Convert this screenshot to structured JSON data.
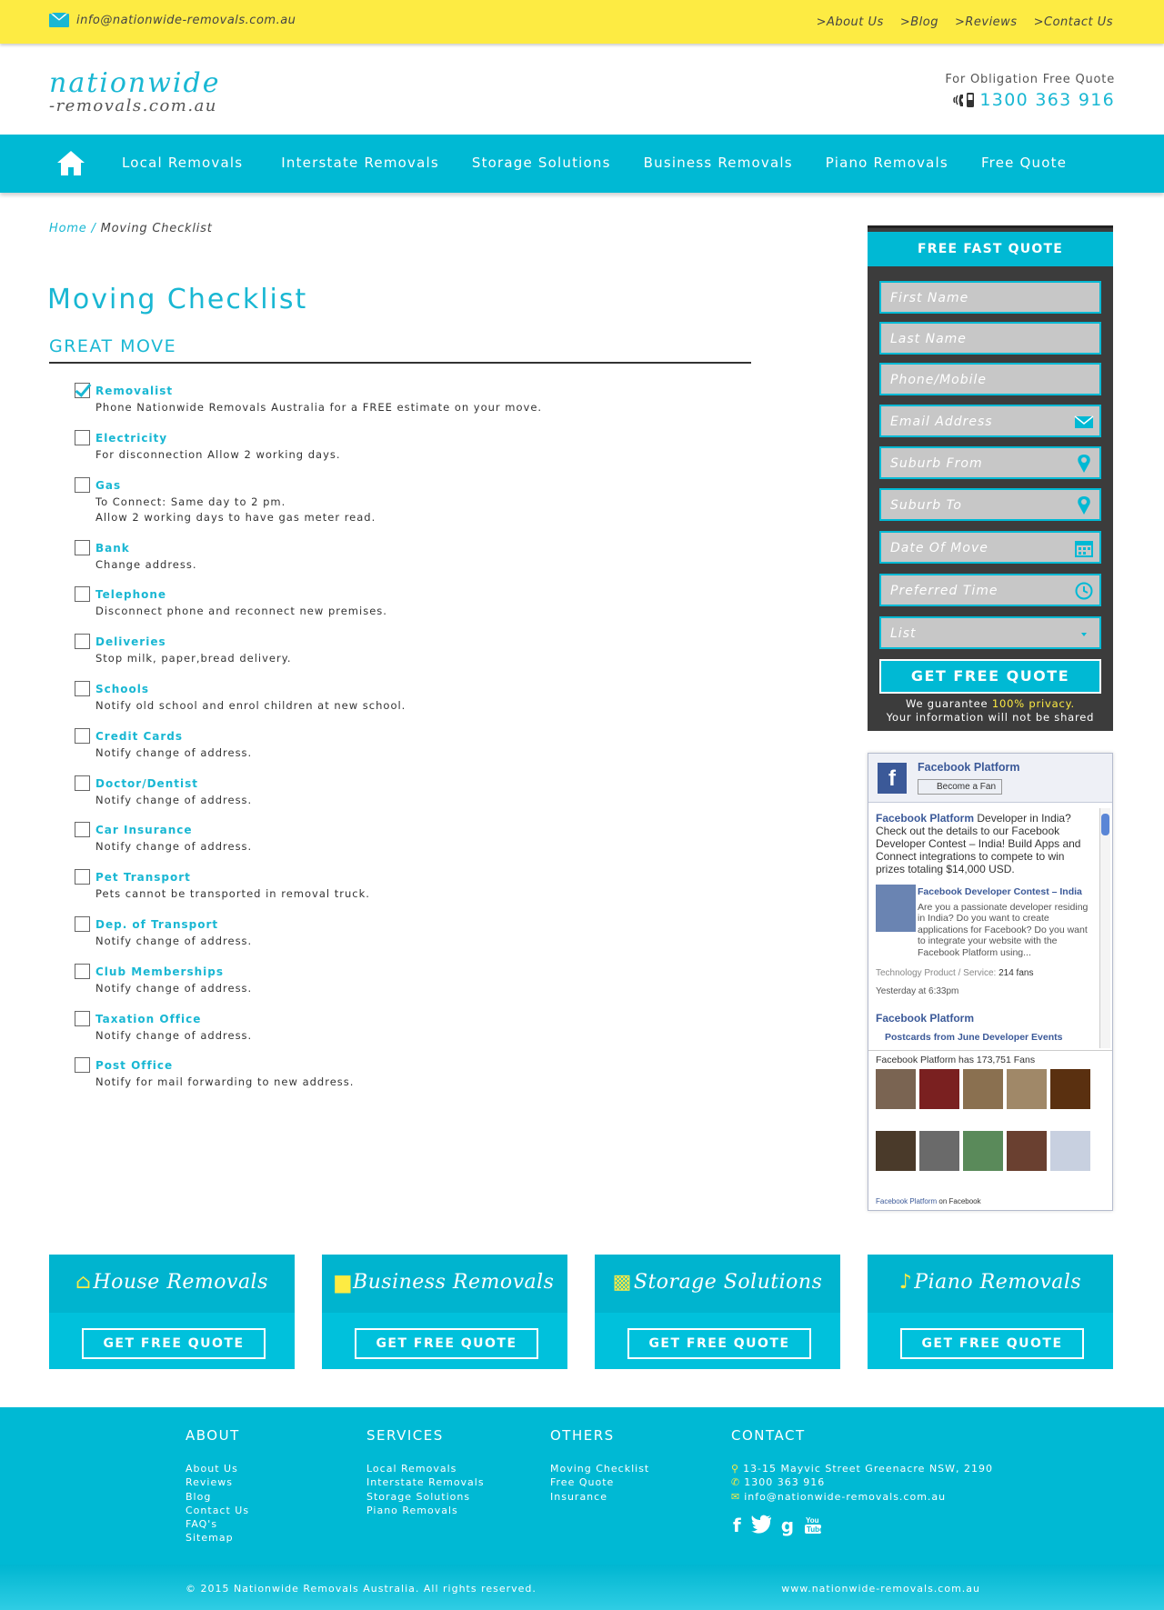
{
  "topbar": {
    "email": "info@nationwide-removals.com.au",
    "links": [
      ">About Us",
      ">Blog",
      ">Reviews",
      ">Contact Us"
    ]
  },
  "logo": {
    "line1": "nationwide",
    "line2": "-removals.com.au"
  },
  "header_quote": {
    "label": "For Obligation Free Quote",
    "phone": "1300 363 916"
  },
  "nav": {
    "items": [
      "Local Removals",
      "Interstate Removals",
      "Storage Solutions",
      "Business Removals",
      "Piano Removals",
      "Free Quote"
    ]
  },
  "breadcrumb": {
    "home": "Home",
    "sep": "/",
    "current": "Moving Checklist"
  },
  "page": {
    "title": "Moving Checklist",
    "subtitle": "GREAT MOVE"
  },
  "checklist": [
    {
      "title": "Removalist",
      "desc": "Phone Nationwide Removals Australia for a FREE estimate on your move.",
      "checked": true
    },
    {
      "title": "Electricity",
      "desc": "For disconnection Allow 2 working days.",
      "checked": false
    },
    {
      "title": "Gas",
      "desc": "To Connect: Same day to 2 pm.\nAllow 2 working days to have gas meter read.",
      "checked": false
    },
    {
      "title": "Bank",
      "desc": "Change address.",
      "checked": false
    },
    {
      "title": "Telephone",
      "desc": "Disconnect phone and reconnect new premises.",
      "checked": false
    },
    {
      "title": "Deliveries",
      "desc": "Stop milk, paper,bread delivery.",
      "checked": false
    },
    {
      "title": "Schools",
      "desc": "Notify old school and enrol children at new school.",
      "checked": false
    },
    {
      "title": "Credit Cards",
      "desc": "Notify change of address.",
      "checked": false
    },
    {
      "title": "Doctor/Dentist",
      "desc": "Notify change of address.",
      "checked": false
    },
    {
      "title": "Car Insurance",
      "desc": "Notify change of address.",
      "checked": false
    },
    {
      "title": "Pet Transport",
      "desc": "Pets cannot be transported in removal truck.",
      "checked": false
    },
    {
      "title": "Dep. of Transport",
      "desc": "Notify change of address.",
      "checked": false
    },
    {
      "title": "Club Memberships",
      "desc": "Notify change of address.",
      "checked": false
    },
    {
      "title": "Taxation Office",
      "desc": "Notify change of address.",
      "checked": false
    },
    {
      "title": "Post Office",
      "desc": "Notify for mail forwarding to new address.",
      "checked": false
    }
  ],
  "quote_form": {
    "heading": "FREE FAST QUOTE",
    "fields": [
      "First Name",
      "Last Name",
      "Phone/Mobile",
      "Email Address",
      "Suburb From",
      "Suburb To",
      "Date Of Move",
      "Preferred Time",
      "List"
    ],
    "button": "GET FREE QUOTE",
    "privacy_pre": "We guarantee",
    "privacy_highlight": "100% privacy.",
    "privacy_line2": "Your information will not be shared"
  },
  "facebook": {
    "page_name": "Facebook Platform",
    "fan_button": "Become a Fan",
    "post_author": "Facebook Platform",
    "post_text": "Developer in India? Check out the details to our Facebook Developer Contest – India! Build Apps and Connect integrations to compete to win prizes totaling $14,000 USD.",
    "link_title": "Facebook Developer Contest – India",
    "link_desc": "Are you a passionate developer residing in India? Do you want to create applications for Facebook? Do you want to integrate your website with the Facebook Platform using...",
    "category": "Technology Product / Service:",
    "fans_count_short": "214 fans",
    "time": "Yesterday at 6:33pm",
    "post2_author": "Facebook Platform",
    "post2_title": "Postcards from June Developer Events",
    "fans_line": "Facebook Platform has 173,751 Fans",
    "footer_link": "Facebook Platform",
    "footer_text": "on Facebook"
  },
  "cards": [
    {
      "title": "House Removals",
      "button": "GET FREE QUOTE"
    },
    {
      "title": "Business Removals",
      "button": "GET FREE QUOTE"
    },
    {
      "title": "Storage Solutions",
      "button": "GET FREE QUOTE"
    },
    {
      "title": "Piano Removals",
      "button": "GET FREE QUOTE"
    }
  ],
  "footer": {
    "about": {
      "heading": "ABOUT",
      "links": [
        "About Us",
        "Reviews",
        "Blog",
        "Contact Us",
        "FAQ's",
        "Sitemap"
      ]
    },
    "services": {
      "heading": "SERVICES",
      "links": [
        "Local Removals",
        "Interstate Removals",
        "Storage Solutions",
        "Piano Removals"
      ]
    },
    "others": {
      "heading": "OTHERS",
      "links": [
        "Moving Checklist",
        "Free Quote",
        "Insurance"
      ]
    },
    "contact": {
      "heading": "CONTACT",
      "address": "13-15 Mayvic Street Greenacre NSW, 2190",
      "phone": "1300 363 916",
      "email": "info@nationwide-removals.com.au"
    },
    "copyright": "© 2015 Nationwide Removals Australia. All rights reserved.",
    "website": "www.nationwide-removals.com.au"
  },
  "colors": {
    "accent": "#00b9d4",
    "topbar": "#fdeb43",
    "form_bg": "#3c3c3c",
    "facebook": "#3b5998"
  }
}
